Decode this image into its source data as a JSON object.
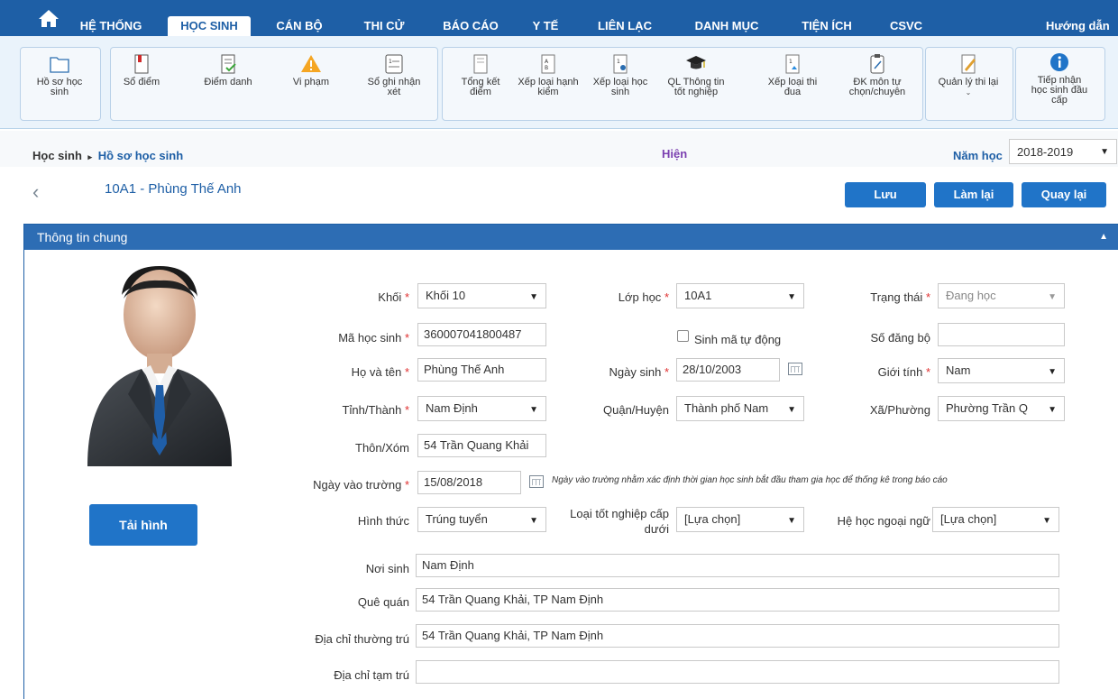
{
  "topnav": {
    "items": [
      "HỆ THỐNG",
      "HỌC SINH",
      "CÁN BỘ",
      "THI CỬ",
      "BÁO CÁO",
      "Y TẾ",
      "LIÊN LẠC",
      "DANH MỤC",
      "TIỆN ÍCH",
      "CSVC"
    ],
    "active": "HỌC SINH",
    "help": "Hướng dẫn"
  },
  "ribbon": {
    "items": [
      {
        "label": "Hồ sơ học\nsinh",
        "icon": "folder-icon"
      },
      {
        "label": "Sổ điểm",
        "icon": "book-icon"
      },
      {
        "label": "Điểm danh",
        "icon": "checklist-icon"
      },
      {
        "label": "Vi phạm",
        "icon": "warning-icon"
      },
      {
        "label": "Sổ ghi nhận\nxét",
        "icon": "notebook-icon"
      },
      {
        "label": "Tổng kết\nđiểm",
        "icon": "summary-icon"
      },
      {
        "label": "Xếp loại hạnh\nkiểm",
        "icon": "conduct-icon"
      },
      {
        "label": "Xếp loại học\nsinh",
        "icon": "rank-icon"
      },
      {
        "label": "QL Thông tin\ntốt nghiệp",
        "icon": "graduation-cap-icon"
      },
      {
        "label": "Xếp loại thi\nđua",
        "icon": "emulation-icon"
      },
      {
        "label": "ĐK môn tự\nchọn/chuyên",
        "icon": "clipboard-icon"
      },
      {
        "label": "Quản lý thi lại",
        "icon": "pencil-doc-icon"
      },
      {
        "label": "Tiếp nhận\nhọc sinh đầu\ncấp",
        "icon": "info-icon"
      }
    ]
  },
  "breadcrumb": {
    "section": "Học sinh",
    "sep": "▸",
    "page": "Hồ sơ học sinh"
  },
  "status_center": "Hiện",
  "year": {
    "label": "Năm học",
    "value": "2018-2019"
  },
  "student_title": "10A1 - Phùng Thế Anh",
  "actions": {
    "save": "Lưu",
    "reset": "Làm lại",
    "back": "Quay lại"
  },
  "panel_title": "Thông tin chung",
  "upload_label": "Tải hình",
  "form": {
    "khoi": {
      "label": "Khối",
      "value": "Khối 10"
    },
    "lop": {
      "label": "Lớp học",
      "value": "10A1"
    },
    "trangthai": {
      "label": "Trạng thái",
      "value": "Đang học"
    },
    "mahs": {
      "label": "Mã học sinh",
      "value": "360007041800487"
    },
    "sinhma": {
      "label": "Sinh mã tự động"
    },
    "sodangbo": {
      "label": "Số đăng bộ",
      "value": ""
    },
    "hoten": {
      "label": "Họ và tên",
      "value": "Phùng Thế Anh"
    },
    "ngaysinh": {
      "label": "Ngày sinh",
      "value": "28/10/2003"
    },
    "gioitinh": {
      "label": "Giới tính",
      "value": "Nam"
    },
    "tinh": {
      "label": "Tỉnh/Thành",
      "value": "Nam Định"
    },
    "quan": {
      "label": "Quận/Huyện",
      "value": "Thành phố Nam"
    },
    "xa": {
      "label": "Xã/Phường",
      "value": "Phường Trần Q"
    },
    "thon": {
      "label": "Thôn/Xóm",
      "value": "54 Trần Quang Khải"
    },
    "ngayvao": {
      "label": "Ngày vào trường",
      "value": "15/08/2018",
      "note": "Ngày vào trường nhằm xác định thời gian học sinh bắt đầu tham gia học để thống kê trong báo cáo"
    },
    "hinhthuc": {
      "label": "Hình thức",
      "value": "Trúng tuyển"
    },
    "loaitn": {
      "label": "Loại tốt nghiệp cấp\ndưới",
      "value": "[Lựa chọn]"
    },
    "ngoaingu": {
      "label": "Hệ học ngoại ngữ",
      "value": "[Lựa chọn]"
    },
    "noisinh": {
      "label": "Nơi sinh",
      "value": "Nam Định"
    },
    "quequan": {
      "label": "Quê quán",
      "value": "54 Trần Quang Khải, TP Nam Định"
    },
    "thuongtru": {
      "label": "Địa chỉ thường trú",
      "value": "54 Trần Quang Khải, TP Nam Định"
    },
    "tamtru": {
      "label": "Địa chỉ tạm trú",
      "value": ""
    }
  },
  "colors": {
    "primary": "#1e5fa6",
    "button": "#2074c8",
    "required": "#e03030",
    "status": "#7b3fb0"
  }
}
